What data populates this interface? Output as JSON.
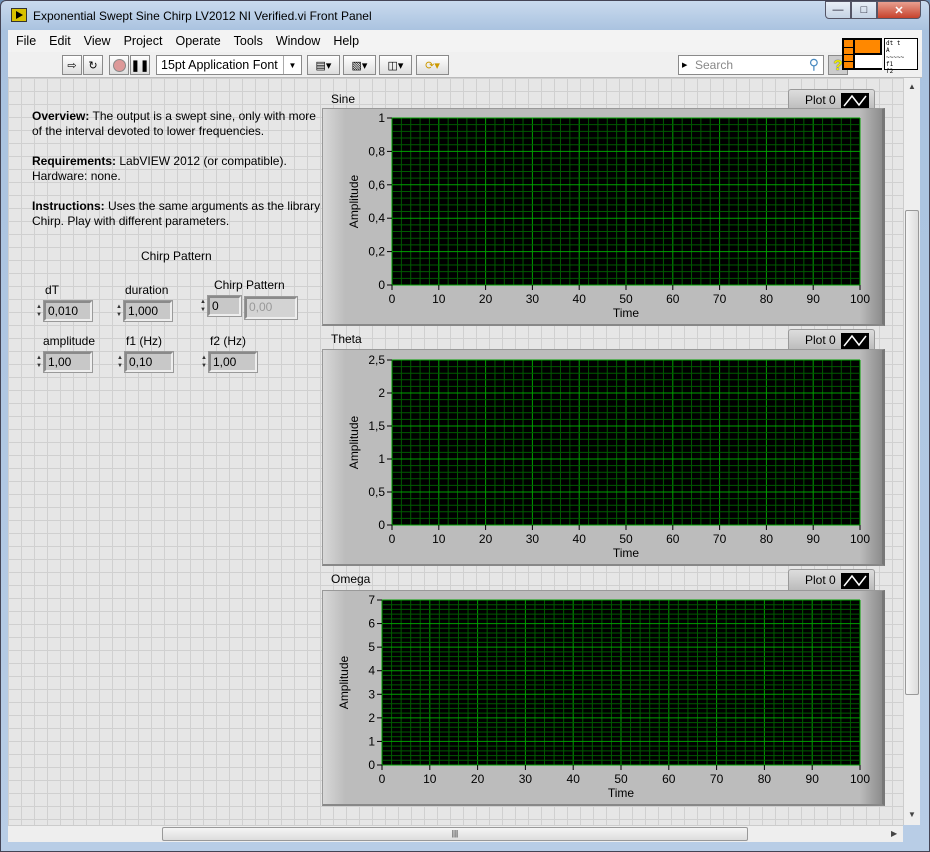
{
  "window": {
    "title": "Exponential Swept Sine Chirp LV2012 NI Verified.vi Front Panel",
    "controls": [
      "minimize",
      "maximize",
      "close"
    ]
  },
  "menu": [
    "File",
    "Edit",
    "View",
    "Project",
    "Operate",
    "Tools",
    "Window",
    "Help"
  ],
  "toolbar": {
    "font": "15pt Application Font",
    "search_placeholder": "Search",
    "help": "?"
  },
  "description": {
    "overview_label": "Overview:",
    "overview_text": " The output is a swept sine, only with more of the interval devoted to lower frequencies.",
    "requirements_label": "Requirements:",
    "requirements_text": " LabVIEW 2012 (or compatible). Hardware: none.",
    "instructions_label": "Instructions:",
    "instructions_text": " Uses the same arguments as the library Chirp. Play with different parameters."
  },
  "controls": {
    "group_label": "Chirp Pattern",
    "dT": {
      "label": "dT",
      "value": "0,010"
    },
    "duration": {
      "label": "duration",
      "value": "1,000"
    },
    "chirp_pattern": {
      "label": "Chirp Pattern",
      "index": "0",
      "value": "0,00"
    },
    "amplitude": {
      "label": "amplitude",
      "value": "1,00"
    },
    "f1": {
      "label": "f1 (Hz)",
      "value": "0,10"
    },
    "f2": {
      "label": "f2 (Hz)",
      "value": "1,00"
    }
  },
  "colors": {
    "plot_bg": "#000000",
    "major_grid": "#00a000",
    "minor_grid": "#005a00"
  },
  "chart_data": [
    {
      "type": "line",
      "title": "Sine",
      "xlabel": "Time",
      "ylabel": "Amplitude",
      "xlim": [
        0,
        100
      ],
      "ylim": [
        0,
        1
      ],
      "xticks": [
        "0",
        "10",
        "20",
        "30",
        "40",
        "50",
        "60",
        "70",
        "80",
        "90",
        "100"
      ],
      "yticks": [
        "0",
        "0,2",
        "0,4",
        "0,6",
        "0,8",
        "1"
      ],
      "legend": [
        "Plot 0"
      ],
      "legend_placement": "top-right",
      "grid": true,
      "series": []
    },
    {
      "type": "line",
      "title": "Theta",
      "xlabel": "Time",
      "ylabel": "Amplitude",
      "xlim": [
        0,
        100
      ],
      "ylim": [
        0,
        2.5
      ],
      "xticks": [
        "0",
        "10",
        "20",
        "30",
        "40",
        "50",
        "60",
        "70",
        "80",
        "90",
        "100"
      ],
      "yticks": [
        "0",
        "0,5",
        "1",
        "1,5",
        "2",
        "2,5"
      ],
      "legend": [
        "Plot 0"
      ],
      "legend_placement": "top-right",
      "grid": true,
      "series": []
    },
    {
      "type": "line",
      "title": "Omega",
      "xlabel": "Time",
      "ylabel": "Amplitude",
      "xlim": [
        0,
        100
      ],
      "ylim": [
        0,
        7
      ],
      "xticks": [
        "0",
        "10",
        "20",
        "30",
        "40",
        "50",
        "60",
        "70",
        "80",
        "90",
        "100"
      ],
      "yticks": [
        "0",
        "1",
        "2",
        "3",
        "4",
        "5",
        "6",
        "7"
      ],
      "legend": [
        "Plot 0"
      ],
      "legend_placement": "top-right",
      "grid": true,
      "series": []
    }
  ]
}
